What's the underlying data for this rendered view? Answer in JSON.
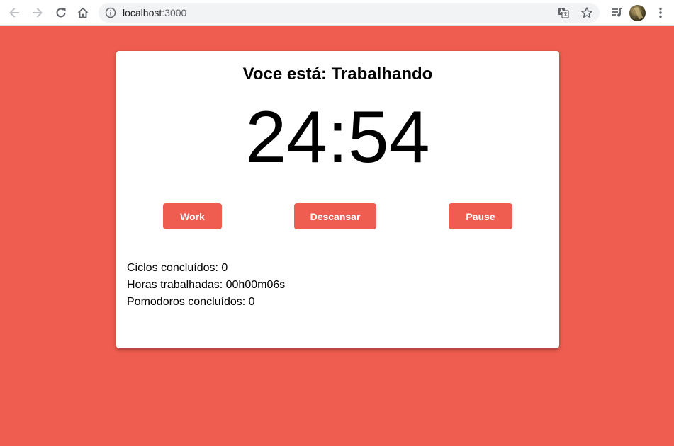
{
  "browser": {
    "url_host": "localhost",
    "url_port": ":3000",
    "icons": [
      "back-icon",
      "forward-icon",
      "reload-icon",
      "home-icon",
      "info-icon",
      "translate-icon",
      "star-icon",
      "media-queue-icon",
      "avatar",
      "menu-icon"
    ]
  },
  "colors": {
    "background": "#ef5d50",
    "button": "#ef5d50",
    "card": "#ffffff"
  },
  "app": {
    "status_title": "Voce está: Trabalhando",
    "timer": "24:54",
    "buttons": {
      "work": "Work",
      "rest": "Descansar",
      "pause": "Pause"
    },
    "stats": {
      "cycles": "Ciclos concluídos: 0",
      "hours": "Horas trabalhadas: 00h00m06s",
      "pomodoros": "Pomodoros concluídos: 0"
    }
  }
}
